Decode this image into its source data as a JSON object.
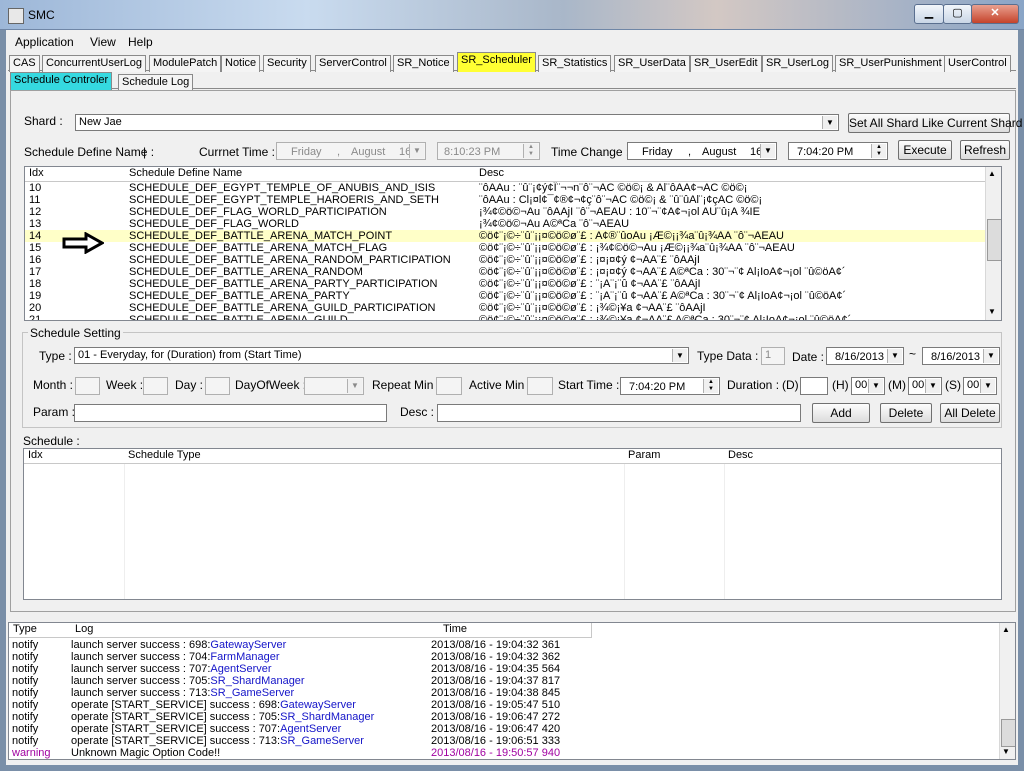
{
  "window": {
    "title": "SMC",
    "minimize": "▁",
    "maximize": "▢",
    "close": "✕"
  },
  "menu": [
    "Application",
    "View",
    "Help"
  ],
  "tabs": [
    "CAS",
    "ConcurrentUserLog",
    "ModulePatch",
    "Notice",
    "Security",
    "ServerControl",
    "SR_Notice",
    "SR_Scheduler",
    "SR_Statistics",
    "SR_UserData",
    "SR_UserEdit",
    "SR_UserLog",
    "SR_UserPunishment",
    "UserControl"
  ],
  "subtabs": [
    "Schedule Controler",
    "Schedule Log"
  ],
  "shard": {
    "label": "Shard :",
    "value": "New Jae",
    "set_all_button": "Set All Shard Like Current Shard"
  },
  "time_bar": {
    "define_label": "Schedule Define Name :",
    "define_value": "|",
    "current_label": "Currnet Time :",
    "current_day": "Friday",
    "current_sep": ",",
    "current_month": "August",
    "current_date": "16",
    "current_time": "8:10:23 PM",
    "change_label": "Time Change :",
    "change_day": "Friday",
    "change_sep": ",",
    "change_month": "August",
    "change_date": "16",
    "change_time": "7:04:20 PM",
    "execute_button": "Execute",
    "refresh_button": "Refresh"
  },
  "define_table": {
    "headers": [
      "Idx",
      "Schedule Define Name",
      "Desc"
    ],
    "rows": [
      {
        "idx": "10",
        "name": "SCHEDULE_DEF_EGYPT_TEMPLE_OF_ANUBIS_AND_ISIS",
        "desc": "¨ôAAu : ¨û¨¡¢ý¢Ï¨¬¬n¨ô¨¬AC ©ö©¡ & Al¨ôAA¢¬AC ©ö©¡"
      },
      {
        "idx": "11",
        "name": "SCHEDULE_DEF_EGYPT_TEMPLE_HAROERIS_AND_SETH",
        "desc": "¨ôAAu : Cl¡¤l¢¯¢®¢¬¢ç¨ô¨¬AC ©ö©¡ & ¨û¨ûAl¨¡¢çAC ©ö©¡"
      },
      {
        "idx": "12",
        "name": "SCHEDULE_DEF_FLAG_WORLD_PARTICIPATION",
        "desc": "¡¾¢©ö©¬Au ¨ôAAjI ¨ô¨¬AEAU : 10¨¬¨¢A¢¬¡ol AU¨û¡A ¾IE"
      },
      {
        "idx": "13",
        "name": "SCHEDULE_DEF_FLAG_WORLD",
        "desc": "¡¾¢©ö©¬Au A©ªCa ¨ô¨¬AEAU"
      },
      {
        "idx": "14",
        "name": "SCHEDULE_DEF_BATTLE_ARENA_MATCH_POINT",
        "desc": "©ö¢¨¡©÷¨û¨¡¡¤©ö©ø¨£ : A¢®¨ûoAu ¡Æ©¡¡¾a¨û¡¾AA ¨ô¨¬AEAU",
        "highlight": true
      },
      {
        "idx": "15",
        "name": "SCHEDULE_DEF_BATTLE_ARENA_MATCH_FLAG",
        "desc": "©ö¢¨¡©÷¨û¨¡¡¤©ö©ø¨£ : ¡¾¢©ö©¬Au ¡Æ©¡¡¾a¨û¡¾AA ¨ô¨¬AEAU"
      },
      {
        "idx": "16",
        "name": "SCHEDULE_DEF_BATTLE_ARENA_RANDOM_PARTICIPATION",
        "desc": "©ö¢¨¡©÷¨û¨¡¡¤©ö©ø¨£ : ¡¤¡¤¢ý ¢¬AA¨£ ¨ôAAjI"
      },
      {
        "idx": "17",
        "name": "SCHEDULE_DEF_BATTLE_ARENA_RANDOM",
        "desc": "©ö¢¨¡©÷¨û¨¡¡¤©ö©ø¨£ : ¡¤¡¤¢ý ¢¬AA¨£ A©ªCa : 30¨¬¨¢ Al¡IoA¢¬¡ol ¨û©öA¢´"
      },
      {
        "idx": "18",
        "name": "SCHEDULE_DEF_BATTLE_ARENA_PARTY_PARTICIPATION",
        "desc": "©ö¢¨¡©÷¨û¨¡¡¤©ö©ø¨£ : ¨¡A¨¡¨û ¢¬AA¨£ ¨ôAAjI"
      },
      {
        "idx": "19",
        "name": "SCHEDULE_DEF_BATTLE_ARENA_PARTY",
        "desc": "©ö¢¨¡©÷¨û¨¡¡¤©ö©ø¨£ : ¨¡A¨¡¨û ¢¬AA¨£ A©ªCa : 30¨¬¨¢ Al¡IoA¢¬¡ol ¨û©öA¢´"
      },
      {
        "idx": "20",
        "name": "SCHEDULE_DEF_BATTLE_ARENA_GUILD_PARTICIPATION",
        "desc": "©ö¢¨¡©÷¨û¨¡¡¤©ö©ø¨£ : ¡¾©¡¥a ¢¬AA¨£ ¨ôAAjI"
      },
      {
        "idx": "21",
        "name": "SCHEDULE_DEF_BATTLE_ARENA_GUILD",
        "desc": "©ö¢¨¡©÷¨û¨¡¡¤©ö©ø¨£ : ¡¾©¡¥a ¢¬AA¨£ A©ªCa : 30¨¬¨¢ Al¡IoA¢¬¡ol ¨û©öA¢´"
      }
    ]
  },
  "setting": {
    "group_label": "Schedule Setting",
    "type_label": "Type :",
    "type_value": "01 - Everyday, for (Duration) from (Start Time)",
    "type_data_label": "Type Data :",
    "type_data_value": "1",
    "date_label": "Date :",
    "date_from": "8/16/2013",
    "date_tilde": "~",
    "date_to": "8/16/2013",
    "month_label": "Month :",
    "week_label": "Week :",
    "day_label": "Day :",
    "dow_label": "DayOfWeek :",
    "repeat_label": "Repeat Min :",
    "active_label": "Active Min :",
    "start_label": "Start Time :",
    "start_value": "7:04:20 PM",
    "duration_label": "Duration :",
    "d_label": "(D)",
    "h_label": "(H)",
    "h_value": "00",
    "m_label": "(M)",
    "m_value": "00",
    "s_label": "(S)",
    "s_value": "00",
    "param_label": "Param :",
    "desc_label": "Desc :",
    "add_button": "Add",
    "delete_button": "Delete",
    "all_delete_button": "All Delete"
  },
  "schedule": {
    "label": "Schedule :",
    "headers": [
      "Idx",
      "Schedule Type",
      "Param",
      "Desc"
    ]
  },
  "log": {
    "headers": [
      "Type",
      "Log",
      "Time"
    ],
    "rows": [
      {
        "type": "notify",
        "pre": "launch server success : ",
        "num": "698:",
        "server": "GatewayServer",
        "time": "2013/08/16 - 19:04:32 361"
      },
      {
        "type": "notify",
        "pre": "launch server success : ",
        "num": "704:",
        "server": "FarmManager",
        "time": "2013/08/16 - 19:04:32 362"
      },
      {
        "type": "notify",
        "pre": "launch server success : ",
        "num": "707:",
        "server": "AgentServer",
        "time": "2013/08/16 - 19:04:35 564"
      },
      {
        "type": "notify",
        "pre": "launch server success : ",
        "num": "705:",
        "server": "SR_ShardManager",
        "time": "2013/08/16 - 19:04:37 817"
      },
      {
        "type": "notify",
        "pre": "launch server success : ",
        "num": "713:",
        "server": "SR_GameServer",
        "time": "2013/08/16 - 19:04:38 845"
      },
      {
        "type": "notify",
        "pre": "operate [START_SERVICE] success : ",
        "num": "698:",
        "server": "GatewayServer",
        "time": "2013/08/16 - 19:05:47 510"
      },
      {
        "type": "notify",
        "pre": "operate [START_SERVICE] success : ",
        "num": "705:",
        "server": "SR_ShardManager",
        "time": "2013/08/16 - 19:06:47 272"
      },
      {
        "type": "notify",
        "pre": "operate [START_SERVICE] success : ",
        "num": "707:",
        "server": "AgentServer",
        "time": "2013/08/16 - 19:06:47 420"
      },
      {
        "type": "notify",
        "pre": "operate [START_SERVICE] success : ",
        "num": "713:",
        "server": "SR_GameServer",
        "time": "2013/08/16 - 19:06:51 333"
      },
      {
        "type": "warning",
        "pre": "Unknown Magic Option Code!!",
        "num": "",
        "server": "",
        "time": "2013/08/16 - 19:50:57 940"
      }
    ]
  },
  "colors": {
    "active_tab": "#ffff33",
    "active_subtab": "#35d9e0",
    "highlight_row": "#ffffc8",
    "server_link": "#1414c8",
    "warning": "#a000a0"
  }
}
